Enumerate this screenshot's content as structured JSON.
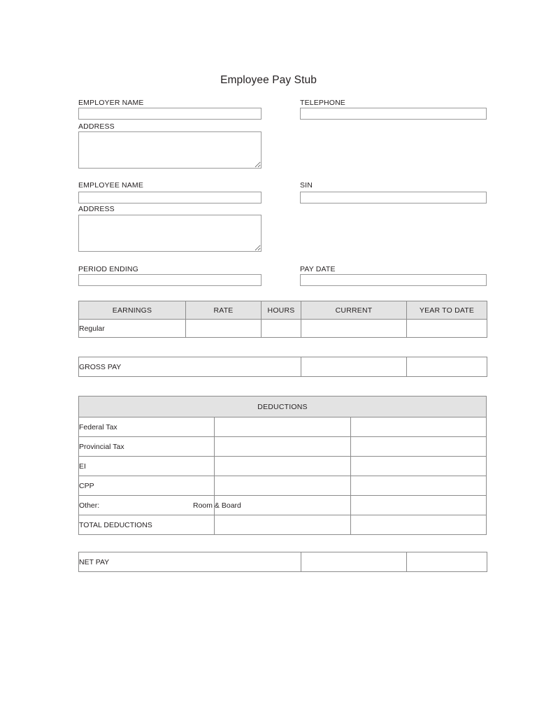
{
  "document": {
    "title": "Employee Pay Stub"
  },
  "employer": {
    "name_label": "EMPLOYER NAME",
    "name_value": "",
    "telephone_label": "TELEPHONE",
    "telephone_value": "",
    "address_label": "ADDRESS",
    "address_value": ""
  },
  "employee": {
    "name_label": "EMPLOYEE NAME",
    "name_value": "",
    "sin_label": "SIN",
    "sin_value": "",
    "address_label": "ADDRESS",
    "address_value": ""
  },
  "period": {
    "period_ending_label": "PERIOD ENDING",
    "period_ending_value": "",
    "pay_date_label": "PAY DATE",
    "pay_date_value": ""
  },
  "earnings": {
    "headers": [
      "EARNINGS",
      "RATE",
      "HOURS",
      "CURRENT",
      "YEAR TO DATE"
    ],
    "rows": [
      {
        "description": "Regular",
        "rate": "",
        "hours": "",
        "current": "",
        "year_to_date": ""
      }
    ]
  },
  "gross_pay": {
    "label": "GROSS PAY",
    "current": "",
    "year_to_date": ""
  },
  "deductions": {
    "title": "DEDUCTIONS",
    "rows": [
      {
        "label": "Federal Tax",
        "sub_label": "",
        "current": "",
        "year_to_date": ""
      },
      {
        "label": "Provincial Tax",
        "sub_label": "",
        "current": "",
        "year_to_date": ""
      },
      {
        "label": "EI",
        "sub_label": "",
        "current": "",
        "year_to_date": ""
      },
      {
        "label": "CPP",
        "sub_label": "",
        "current": "",
        "year_to_date": ""
      },
      {
        "label": "Other:",
        "sub_label": "Room & Board",
        "current": "",
        "year_to_date": ""
      },
      {
        "label": "TOTAL DEDUCTIONS",
        "sub_label": "",
        "current": "",
        "year_to_date": ""
      }
    ]
  },
  "net_pay": {
    "label": "NET PAY",
    "current": "",
    "year_to_date": ""
  },
  "colors": {
    "header_fill": "#e3e3e3",
    "border": "#8c8c8c",
    "field_border": "#9a9a9a",
    "text": "#231f20",
    "background": "#ffffff"
  }
}
